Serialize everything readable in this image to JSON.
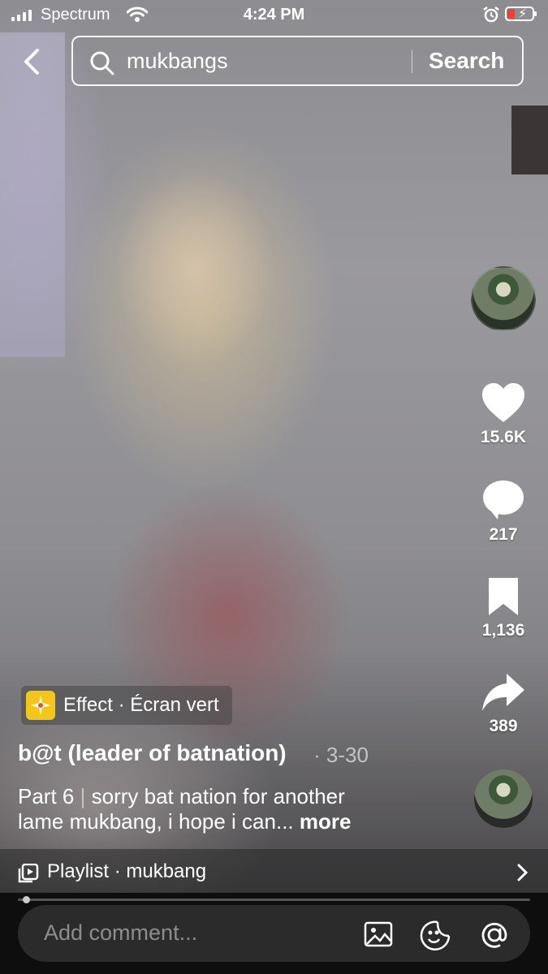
{
  "status_bar": {
    "carrier": "Spectrum",
    "time": "4:24 PM"
  },
  "search": {
    "query": "mukbangs",
    "button_label": "Search"
  },
  "actions": {
    "likes": "15.6K",
    "comments": "217",
    "saves": "1,136",
    "shares": "389"
  },
  "effect": {
    "label": "Effect · Écran vert"
  },
  "post": {
    "username": "b@t (leader of batnation)",
    "date": "· 3-30",
    "part": "Part 6",
    "separator": "|",
    "caption_line1": "sorry bat nation for another",
    "caption_line2": "lame mukbang, i hope i can...",
    "more_label": "more"
  },
  "playlist": {
    "label": "Playlist · mukbang"
  },
  "playback": {
    "progress_fraction": 0.01
  },
  "comment_bar": {
    "placeholder": "Add comment..."
  },
  "colors": {
    "battery_low": "#ff3b30",
    "effect_icon_bg": "#f5c518"
  }
}
